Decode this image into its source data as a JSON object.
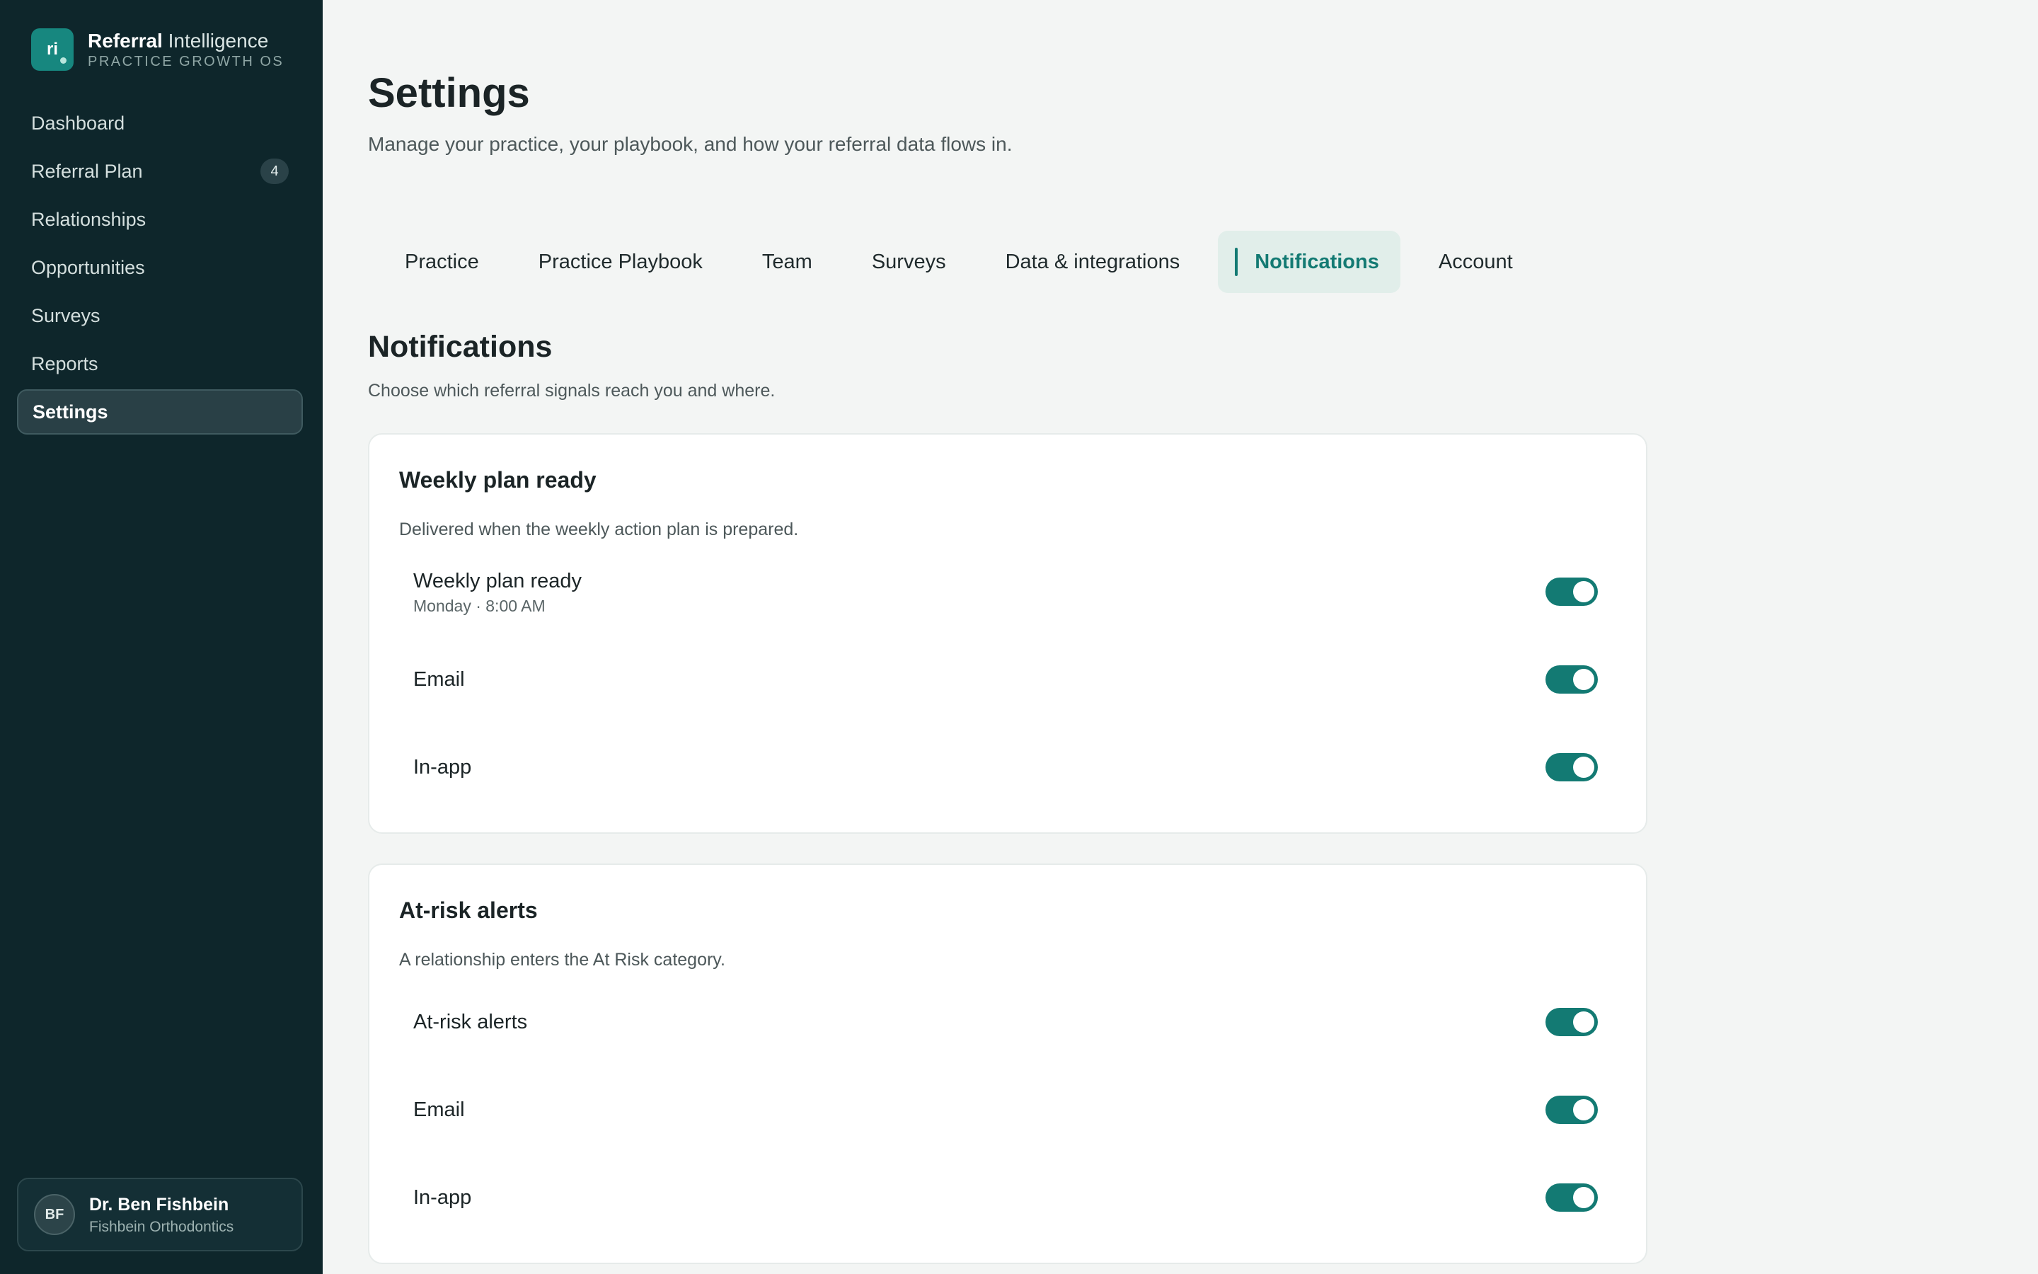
{
  "brand": {
    "logo_text": "ri",
    "name_bold": "Referral",
    "name_light": " Intelligence",
    "subtitle": "PRACTICE GROWTH OS"
  },
  "sidebar": {
    "items": [
      {
        "label": "Dashboard"
      },
      {
        "label": "Referral Plan",
        "badge": "4"
      },
      {
        "label": "Relationships"
      },
      {
        "label": "Opportunities"
      },
      {
        "label": "Surveys"
      },
      {
        "label": "Reports"
      },
      {
        "label": "Settings",
        "active": true
      }
    ]
  },
  "user": {
    "initials": "BF",
    "name": "Dr. Ben Fishbein",
    "org": "Fishbein Orthodontics"
  },
  "header": {
    "title": "Settings",
    "subtitle": "Manage your practice, your playbook, and how your referral data flows in."
  },
  "tabs": [
    {
      "label": "Practice"
    },
    {
      "label": "Practice Playbook"
    },
    {
      "label": "Team"
    },
    {
      "label": "Surveys"
    },
    {
      "label": "Data & integrations"
    },
    {
      "label": "Notifications",
      "active": true
    },
    {
      "label": "Account"
    }
  ],
  "section": {
    "title": "Notifications",
    "subtitle": "Choose which referral signals reach you and where."
  },
  "cards": [
    {
      "title": "Weekly plan ready",
      "description": "Delivered when the weekly action plan is prepared.",
      "rows": [
        {
          "label": "Weekly plan ready",
          "meta": "Monday · 8:00 AM",
          "enabled": true
        },
        {
          "label": "Email",
          "enabled": true
        },
        {
          "label": "In-app",
          "enabled": true
        }
      ]
    },
    {
      "title": "At-risk alerts",
      "description": "A relationship enters the At Risk category.",
      "rows": [
        {
          "label": "At-risk alerts",
          "enabled": true
        },
        {
          "label": "Email",
          "enabled": true
        },
        {
          "label": "In-app",
          "enabled": true
        }
      ]
    }
  ],
  "colors": {
    "sidebar_bg": "#0e262b",
    "accent": "#137a73",
    "page_bg": "#f3f5f4"
  }
}
